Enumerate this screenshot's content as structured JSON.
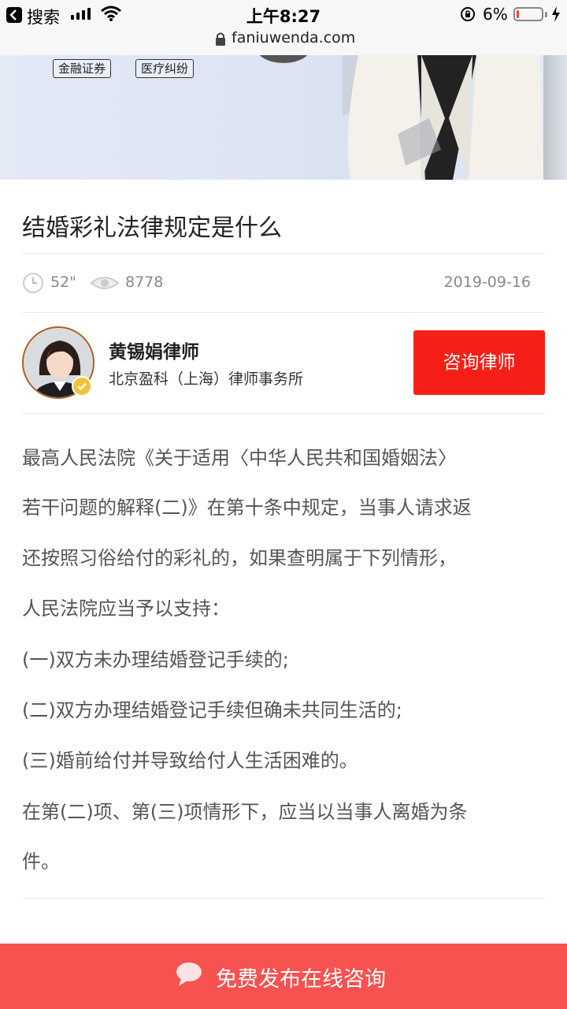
{
  "status_bar": {
    "back_label": "搜索",
    "time": "上午8:27",
    "battery": "6%",
    "battery_level": 0.06
  },
  "url_bar": {
    "url": "faniuwenda.com"
  },
  "banner": {
    "tags": [
      "金融证券",
      "医疗纠纷"
    ]
  },
  "article": {
    "title": "结婚彩礼法律规定是什么",
    "duration": "52\"",
    "views": "8778",
    "date": "2019-09-16"
  },
  "lawyer": {
    "name": "黄锡娟律师",
    "firm": "北京盈科（上海）律师事务所",
    "consult_label": "咨询律师"
  },
  "content": {
    "lines": [
      "最高人民法院《关于适用〈中华人民共和国婚姻法〉",
      "若干问题的解释(二)》在第十条中规定，当事人请求返",
      "还按照习俗给付的彩礼的，如果查明属于下列情形，",
      "人民法院应当予以支持：",
      "(一)双方未办理结婚登记手续的;",
      "(二)双方办理结婚登记手续但确未共同生活的;",
      "(三)婚前给付并导致给付人生活困难的。",
      "在第(二)项、第(三)项情形下，应当以当事人离婚为条",
      "件。"
    ]
  },
  "bottom_bar": {
    "label": "免费发布在线咨询"
  },
  "colors": {
    "accent_red": "#f61f17",
    "bottom_bar": "#f65250"
  },
  "icons": [
    "back-icon",
    "signal-icon",
    "wifi-icon",
    "rotation-lock-icon",
    "battery-icon",
    "charging-icon",
    "lock-icon",
    "clock-icon",
    "eye-icon",
    "verified-badge-icon",
    "chat-bubble-icon"
  ]
}
